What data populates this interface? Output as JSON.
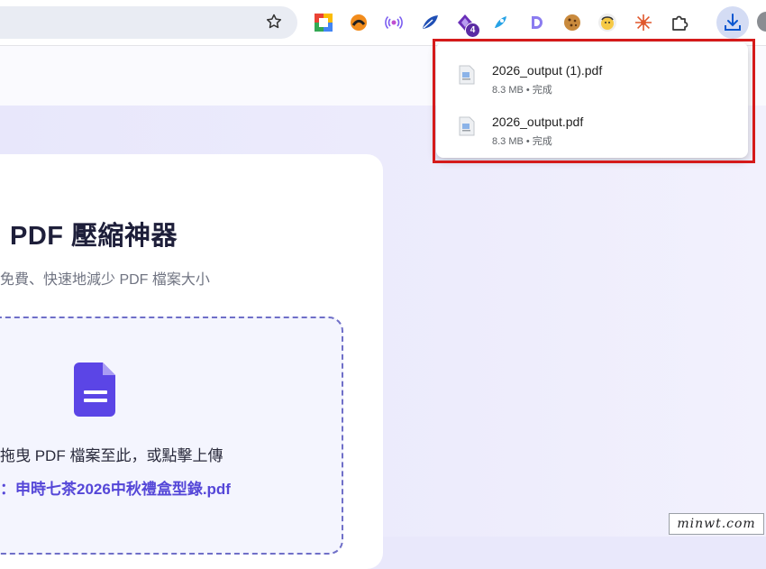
{
  "toolbar": {
    "extensions": [
      {
        "name": "google-keep-extension-icon"
      },
      {
        "name": "orange-swirl-extension-icon"
      },
      {
        "name": "broadcast-extension-icon"
      },
      {
        "name": "blue-feather-extension-icon"
      },
      {
        "name": "diamond-extension-icon",
        "badge": "4"
      },
      {
        "name": "rocket-extension-icon"
      },
      {
        "name": "d-letter-extension-icon"
      },
      {
        "name": "cookie-extension-icon"
      },
      {
        "name": "face-extension-icon"
      },
      {
        "name": "sun-extension-icon"
      },
      {
        "name": "puzzle-extensions-icon"
      }
    ],
    "download_icon": "download-icon",
    "star_icon": "bookmark-star-icon"
  },
  "page": {
    "title": "PDF 壓縮神器",
    "subtitle": "免費、快速地減少 PDF 檔案大小",
    "dropzone_text": "拖曳 PDF 檔案至此，或點擊上傳",
    "selected_file": "：申時七茶2026中秋禮盒型錄.pdf"
  },
  "downloads": {
    "items": [
      {
        "filename": "2026_output (1).pdf",
        "status": "8.3 MB • 完成"
      },
      {
        "filename": "2026_output.pdf",
        "status": "8.3 MB • 完成"
      }
    ]
  },
  "watermark": "minwt.com",
  "colors": {
    "accent": "#5547d8",
    "highlight_border": "#d51a1a",
    "page_bg": "#e9e8fb"
  }
}
